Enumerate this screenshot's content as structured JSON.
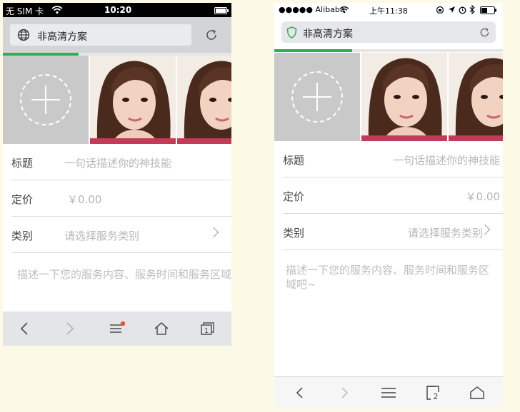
{
  "left": {
    "status": {
      "carrier": "无 SIM 卡",
      "time": "10:20"
    },
    "address": {
      "title": "非高清方案"
    },
    "progress": 0.33,
    "form": {
      "title_label": "标题",
      "title_placeholder": "一句话描述你的神技能",
      "price_label": "定价",
      "price_placeholder": "￥0.00",
      "category_label": "类别",
      "category_placeholder": "请选择服务类别",
      "description_placeholder": "描述一下您的服务内容、服务时间和服务区域吧~"
    },
    "toolbar_icons": [
      "back-icon",
      "forward-icon",
      "menu-icon",
      "home-icon",
      "tabs-icon"
    ],
    "tabs_count": "1"
  },
  "right": {
    "status": {
      "carrier": "●●●●● Alibaba",
      "time": "上午11:38"
    },
    "address": {
      "title": "非高清方案"
    },
    "progress": 0.34,
    "form": {
      "title_label": "标题",
      "title_placeholder": "一句话描述你的神技能",
      "price_label": "定价",
      "price_placeholder": "￥0.00",
      "category_label": "类别",
      "category_placeholder": "请选择服务类别",
      "description_placeholder": "描述一下您的服务内容、服务时间和服务区域吧~"
    },
    "toolbar_icons": [
      "back-icon",
      "forward-icon",
      "menu-icon",
      "tabs-icon",
      "home-icon"
    ],
    "tabs_count": "2"
  },
  "colors": {
    "progress": "#2cb150",
    "notification_dot": "#e8552f",
    "image_placeholder": "#c9c9c9"
  }
}
